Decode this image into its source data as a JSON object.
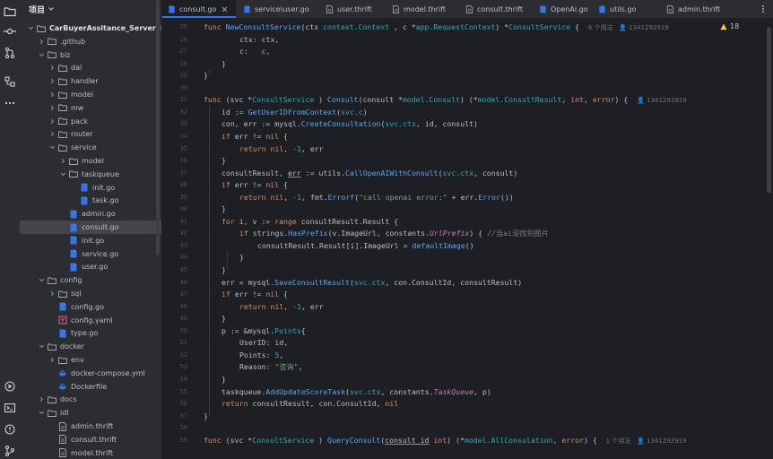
{
  "project": {
    "title": "项目",
    "tree": [
      {
        "depth": 0,
        "chev": "down",
        "icon": "folder",
        "label": "CarBuyerAssitance_Server",
        "path": "E:\\stud",
        "bold": true
      },
      {
        "depth": 1,
        "chev": "right",
        "icon": "folder",
        "label": ".github"
      },
      {
        "depth": 1,
        "chev": "down",
        "icon": "folder",
        "label": "biz"
      },
      {
        "depth": 2,
        "chev": "right",
        "icon": "folder",
        "label": "dal"
      },
      {
        "depth": 2,
        "chev": "right",
        "icon": "folder",
        "label": "handler"
      },
      {
        "depth": 2,
        "chev": "right",
        "icon": "folder",
        "label": "model"
      },
      {
        "depth": 2,
        "chev": "right",
        "icon": "folder",
        "label": "mw"
      },
      {
        "depth": 2,
        "chev": "right",
        "icon": "folder",
        "label": "pack"
      },
      {
        "depth": 2,
        "chev": "right",
        "icon": "folder",
        "label": "router"
      },
      {
        "depth": 2,
        "chev": "down",
        "icon": "folder",
        "label": "service"
      },
      {
        "depth": 3,
        "chev": "right",
        "icon": "folder",
        "label": "model"
      },
      {
        "depth": 3,
        "chev": "down",
        "icon": "folder",
        "label": "taskqueue"
      },
      {
        "depth": 4,
        "chev": "none",
        "icon": "go",
        "label": "init.go"
      },
      {
        "depth": 4,
        "chev": "none",
        "icon": "go",
        "label": "task.go"
      },
      {
        "depth": 3,
        "chev": "none",
        "icon": "go",
        "label": "admin.go"
      },
      {
        "depth": 3,
        "chev": "none",
        "icon": "go",
        "label": "consult.go",
        "selected": true
      },
      {
        "depth": 3,
        "chev": "none",
        "icon": "go",
        "label": "init.go"
      },
      {
        "depth": 3,
        "chev": "none",
        "icon": "go",
        "label": "service.go"
      },
      {
        "depth": 3,
        "chev": "none",
        "icon": "go",
        "label": "user.go"
      },
      {
        "depth": 1,
        "chev": "down",
        "icon": "folder",
        "label": "config"
      },
      {
        "depth": 2,
        "chev": "right",
        "icon": "folder",
        "label": "sql"
      },
      {
        "depth": 2,
        "chev": "none",
        "icon": "go",
        "label": "config.go"
      },
      {
        "depth": 2,
        "chev": "none",
        "icon": "yaml",
        "label": "config.yaml"
      },
      {
        "depth": 2,
        "chev": "none",
        "icon": "go",
        "label": "type.go"
      },
      {
        "depth": 1,
        "chev": "down",
        "icon": "folder",
        "label": "docker"
      },
      {
        "depth": 2,
        "chev": "right",
        "icon": "folder",
        "label": "env"
      },
      {
        "depth": 2,
        "chev": "none",
        "icon": "docker",
        "label": "docker-compose.yml"
      },
      {
        "depth": 2,
        "chev": "none",
        "icon": "docker",
        "label": "Dockerfile"
      },
      {
        "depth": 1,
        "chev": "right",
        "icon": "folder",
        "label": "docs"
      },
      {
        "depth": 1,
        "chev": "down",
        "icon": "folder",
        "label": "idl"
      },
      {
        "depth": 2,
        "chev": "none",
        "icon": "thrift",
        "label": "admin.thrift"
      },
      {
        "depth": 2,
        "chev": "none",
        "icon": "thrift",
        "label": "consult.thrift"
      },
      {
        "depth": 2,
        "chev": "none",
        "icon": "thrift",
        "label": "model.thrift"
      }
    ]
  },
  "tabs": [
    {
      "label": "consult.go",
      "icon": "go",
      "active": true
    },
    {
      "label": "service\\user.go",
      "icon": "go"
    },
    {
      "label": "user.thrift",
      "icon": "thrift"
    },
    {
      "label": "model.thrift",
      "icon": "thrift"
    },
    {
      "label": "consult.thrift",
      "icon": "thrift"
    },
    {
      "label": "OpenAi.go",
      "icon": "go"
    },
    {
      "label": "utils.go",
      "icon": "go"
    },
    {
      "label": "admin.thrift",
      "icon": "thrift"
    }
  ],
  "editor": {
    "warning_count": "18",
    "lines": [
      {
        "n": "25",
        "ind": 0,
        "segs": [
          [
            "kw",
            "func "
          ],
          [
            "fn",
            "NewConsultService"
          ],
          [
            "",
            "(ctx "
          ],
          [
            "ty",
            "context.Context"
          ],
          [
            "",
            " , c *"
          ],
          [
            "ty",
            "app.RequestContext"
          ],
          [
            "",
            ") *"
          ],
          [
            "ty",
            "ConsultService"
          ],
          [
            "",
            " {  "
          ],
          [
            "hint",
            "6 个用法"
          ],
          [
            "hint",
            "   👤 1341292919"
          ]
        ]
      },
      {
        "n": "26",
        "ind": 2,
        "segs": [
          [
            "",
            "ctx: ctx,"
          ]
        ]
      },
      {
        "n": "27",
        "ind": 2,
        "segs": [
          [
            "",
            "c:   c,"
          ]
        ]
      },
      {
        "n": "28",
        "ind": 1,
        "segs": [
          [
            "",
            "}"
          ]
        ]
      },
      {
        "n": "29",
        "ind": 0,
        "segs": [
          [
            "",
            "}"
          ]
        ]
      },
      {
        "n": "30",
        "ind": 0,
        "segs": [
          [
            "",
            ""
          ]
        ]
      },
      {
        "n": "31",
        "ind": 0,
        "segs": [
          [
            "kw",
            "func "
          ],
          [
            "",
            "(svc *"
          ],
          [
            "ty",
            "ConsultService"
          ],
          [
            "",
            " ) "
          ],
          [
            "fn",
            "Consult"
          ],
          [
            "",
            "(consult *"
          ],
          [
            "ty",
            "model.Consult"
          ],
          [
            "",
            ") (*"
          ],
          [
            "ty",
            "model.ConsultResult"
          ],
          [
            "",
            ", "
          ],
          [
            "kw",
            "int"
          ],
          [
            "",
            ", "
          ],
          [
            "kw",
            "error"
          ],
          [
            "",
            ") {  "
          ],
          [
            "hint",
            "👤 1341292919"
          ]
        ]
      },
      {
        "n": "32",
        "ind": 1,
        "segs": [
          [
            "",
            "id := "
          ],
          [
            "fn",
            "GetUserIDFromContext"
          ],
          [
            "",
            "("
          ],
          [
            "ty",
            "svc.c"
          ],
          [
            "",
            ")"
          ]
        ]
      },
      {
        "n": "33",
        "ind": 1,
        "segs": [
          [
            "",
            "con, err := "
          ],
          [
            "pkg",
            "mysql."
          ],
          [
            "fn",
            "CreateConsultation"
          ],
          [
            "",
            "("
          ],
          [
            "ty",
            "svc.ctx"
          ],
          [
            "",
            ", id, consult)"
          ]
        ]
      },
      {
        "n": "34",
        "ind": 1,
        "segs": [
          [
            "kw",
            "if "
          ],
          [
            "",
            "err != "
          ],
          [
            "kw",
            "nil"
          ],
          [
            "",
            " {"
          ]
        ]
      },
      {
        "n": "35",
        "ind": 2,
        "segs": [
          [
            "kw",
            "return "
          ],
          [
            "kw",
            "nil"
          ],
          [
            "",
            ", "
          ],
          [
            "num",
            "-1"
          ],
          [
            "",
            ", err"
          ]
        ]
      },
      {
        "n": "36",
        "ind": 1,
        "segs": [
          [
            "",
            "}"
          ]
        ]
      },
      {
        "n": "37",
        "ind": 1,
        "segs": [
          [
            "",
            "consultResult, "
          ],
          [
            "under",
            "err"
          ],
          [
            "",
            " := "
          ],
          [
            "pkg",
            "utils."
          ],
          [
            "fn",
            "CallOpenAIWithConsult"
          ],
          [
            "",
            "("
          ],
          [
            "ty",
            "svc.ctx"
          ],
          [
            "",
            ", consult)"
          ]
        ]
      },
      {
        "n": "38",
        "ind": 1,
        "segs": [
          [
            "kw",
            "if "
          ],
          [
            "",
            "err != "
          ],
          [
            "kw",
            "nil"
          ],
          [
            "",
            " {"
          ]
        ]
      },
      {
        "n": "39",
        "ind": 2,
        "segs": [
          [
            "kw",
            "return "
          ],
          [
            "kw",
            "nil"
          ],
          [
            "",
            ", "
          ],
          [
            "num",
            "-1"
          ],
          [
            "",
            ", "
          ],
          [
            "pkg",
            "fmt."
          ],
          [
            "fn",
            "Errorf"
          ],
          [
            "",
            "("
          ],
          [
            "str",
            "\"call openai error:\""
          ],
          [
            "",
            " + err."
          ],
          [
            "fn",
            "Error"
          ],
          [
            "",
            "())"
          ]
        ]
      },
      {
        "n": "40",
        "ind": 1,
        "segs": [
          [
            "",
            "}"
          ]
        ]
      },
      {
        "n": "41",
        "ind": 1,
        "segs": [
          [
            "kw",
            "for "
          ],
          [
            "",
            "i, v := "
          ],
          [
            "kw",
            "range "
          ],
          [
            "",
            "consultResult.Result {"
          ]
        ]
      },
      {
        "n": "42",
        "ind": 2,
        "segs": [
          [
            "kw",
            "if "
          ],
          [
            "pkg",
            "strings."
          ],
          [
            "fn",
            "HasPrefix"
          ],
          [
            "",
            "(v.ImageUrl, "
          ],
          [
            "pkg",
            "constants."
          ],
          [
            "cn",
            "UrlPrefix"
          ],
          [
            "",
            ") { "
          ],
          [
            "cm",
            "//当ai没找到图片"
          ]
        ]
      },
      {
        "n": "43",
        "ind": 3,
        "segs": [
          [
            "",
            "consultResult.Result[i].ImageUrl = "
          ],
          [
            "fn",
            "defaultImage"
          ],
          [
            "",
            "()"
          ]
        ]
      },
      {
        "n": "44",
        "ind": 2,
        "segs": [
          [
            "",
            "}"
          ]
        ]
      },
      {
        "n": "45",
        "ind": 1,
        "segs": [
          [
            "",
            "}"
          ]
        ]
      },
      {
        "n": "46",
        "ind": 1,
        "segs": [
          [
            "",
            "err = "
          ],
          [
            "pkg",
            "mysql."
          ],
          [
            "fn",
            "SaveConsultResult"
          ],
          [
            "",
            "("
          ],
          [
            "ty",
            "svc.ctx"
          ],
          [
            "",
            ", con.ConsultId, consultResult)"
          ]
        ]
      },
      {
        "n": "47",
        "ind": 1,
        "segs": [
          [
            "kw",
            "if "
          ],
          [
            "",
            "err != "
          ],
          [
            "kw",
            "nil"
          ],
          [
            "",
            " {"
          ]
        ]
      },
      {
        "n": "48",
        "ind": 2,
        "segs": [
          [
            "kw",
            "return "
          ],
          [
            "kw",
            "nil"
          ],
          [
            "",
            ", "
          ],
          [
            "num",
            "-1"
          ],
          [
            "",
            ", err"
          ]
        ]
      },
      {
        "n": "49",
        "ind": 1,
        "segs": [
          [
            "",
            "}"
          ]
        ]
      },
      {
        "n": "50",
        "ind": 1,
        "segs": [
          [
            "",
            "p := &"
          ],
          [
            "pkg",
            "mysql."
          ],
          [
            "ty",
            "Points"
          ],
          [
            "",
            "{"
          ]
        ]
      },
      {
        "n": "51",
        "ind": 2,
        "segs": [
          [
            "",
            "UserID: id,"
          ]
        ]
      },
      {
        "n": "52",
        "ind": 2,
        "segs": [
          [
            "",
            "Points: "
          ],
          [
            "num",
            "5"
          ],
          [
            "",
            ","
          ]
        ]
      },
      {
        "n": "53",
        "ind": 2,
        "segs": [
          [
            "",
            "Reason: "
          ],
          [
            "str",
            "\"咨询\""
          ],
          [
            "",
            ","
          ]
        ]
      },
      {
        "n": "54",
        "ind": 1,
        "segs": [
          [
            "",
            "}"
          ]
        ]
      },
      {
        "n": "55",
        "ind": 1,
        "segs": [
          [
            "pkg",
            "taskqueue."
          ],
          [
            "fn",
            "AddUpdateScoreTask"
          ],
          [
            "",
            "("
          ],
          [
            "ty",
            "svc.ctx"
          ],
          [
            "",
            ", "
          ],
          [
            "pkg",
            "constants."
          ],
          [
            "cn",
            "TaskQueue"
          ],
          [
            "",
            ", p)"
          ]
        ]
      },
      {
        "n": "56",
        "ind": 1,
        "segs": [
          [
            "kw",
            "return "
          ],
          [
            "",
            "consultResult, con.ConsultId, "
          ],
          [
            "kw",
            "nil"
          ]
        ]
      },
      {
        "n": "57",
        "ind": 0,
        "segs": [
          [
            "",
            "}"
          ]
        ]
      },
      {
        "n": "58",
        "ind": 0,
        "segs": [
          [
            "",
            ""
          ]
        ]
      },
      {
        "n": "59",
        "ind": 0,
        "segs": [
          [
            "kw",
            "func "
          ],
          [
            "",
            "(svc *"
          ],
          [
            "ty",
            "ConsultService"
          ],
          [
            "",
            " ) "
          ],
          [
            "fn",
            "QueryConsult"
          ],
          [
            "",
            "("
          ],
          [
            "under",
            "consult_id"
          ],
          [
            "",
            " "
          ],
          [
            "kw",
            "int"
          ],
          [
            "",
            ") (*"
          ],
          [
            "ty",
            "model.AllConsulation"
          ],
          [
            "",
            ", "
          ],
          [
            "kw",
            "error"
          ],
          [
            "",
            ") {  "
          ],
          [
            "hint",
            "1 个用法"
          ],
          [
            "hint",
            "   👤 1341292919"
          ]
        ]
      }
    ]
  }
}
